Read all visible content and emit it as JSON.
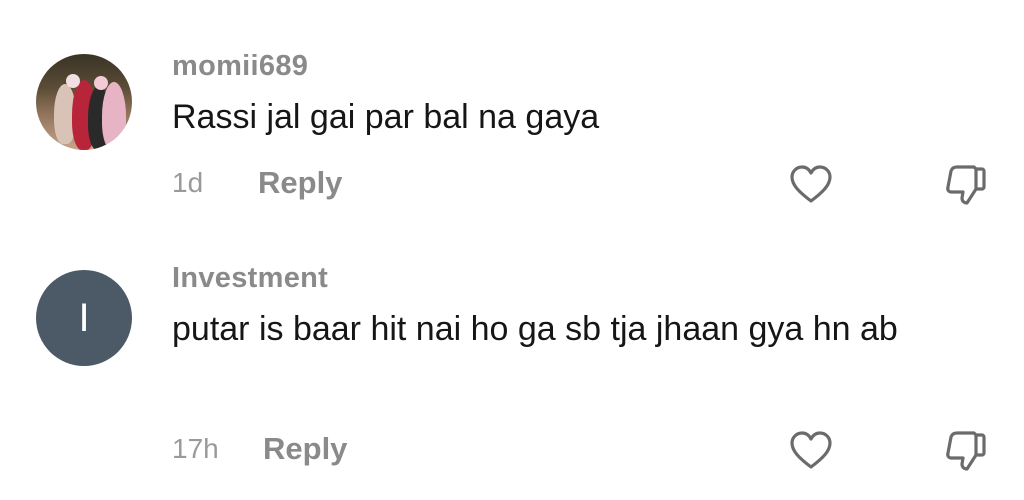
{
  "comments": [
    {
      "username": "momii689",
      "text": "Rassi jal gai par bal na gaya",
      "time": "1d",
      "reply_label": "Reply",
      "avatar_type": "photo"
    },
    {
      "username": "Investment",
      "text": "putar is baar hit nai ho ga sb tja jhaan gya hn ab",
      "time": "17h",
      "reply_label": "Reply",
      "avatar_type": "letter",
      "avatar_letter": "I",
      "avatar_color": "#4b5a66"
    }
  ],
  "icons": {
    "like": "heart-outline-icon",
    "dislike": "thumbs-down-icon"
  },
  "colors": {
    "username": "#8a8a8a",
    "text": "#161616",
    "meta": "#9a9a9a",
    "icon_stroke": "#6b6b6b"
  }
}
